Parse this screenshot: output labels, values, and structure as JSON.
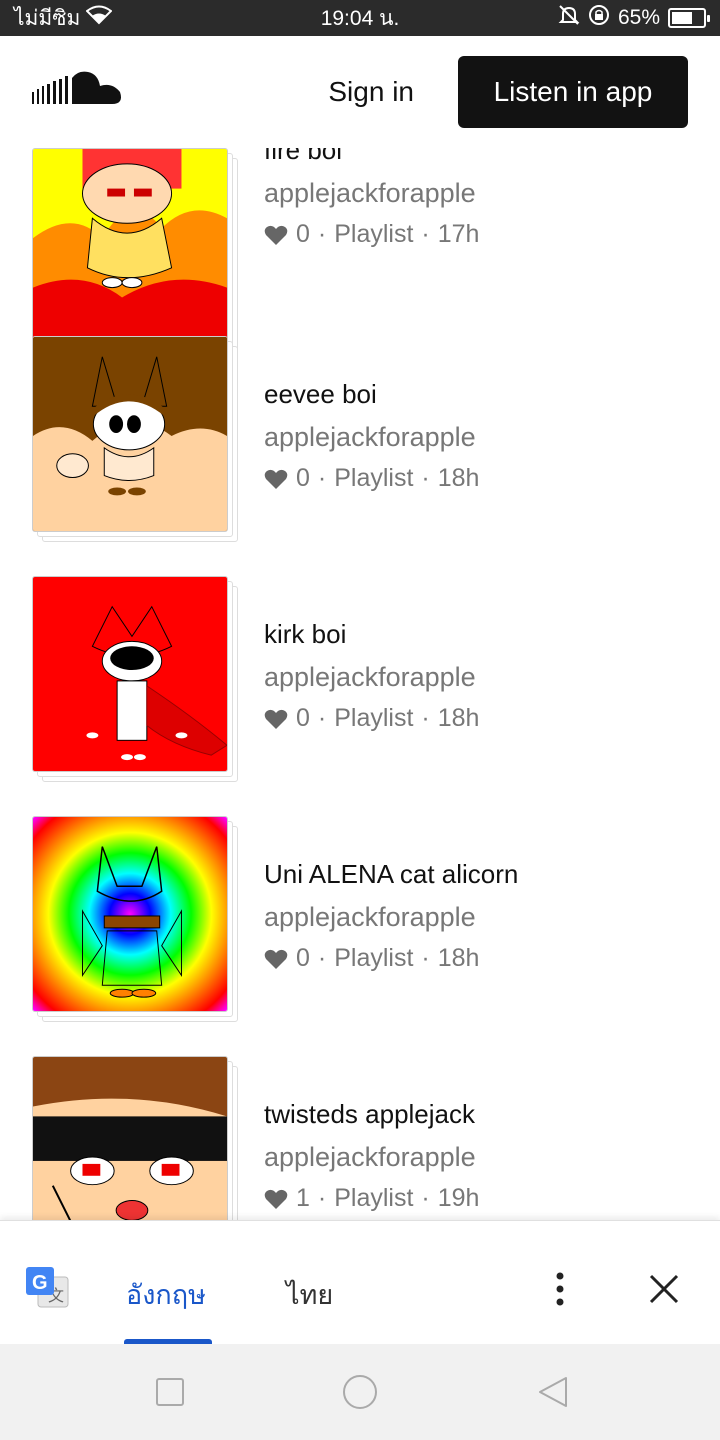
{
  "status": {
    "carrier": "ไม่มีซิม",
    "time": "19:04 น.",
    "battery": "65%",
    "battery_level": 0.65
  },
  "header": {
    "logo": "soundcloud-logo",
    "signin_label": "Sign in",
    "listen_label": "Listen in app"
  },
  "playlists": [
    {
      "title": "fire boi",
      "user": "applejackforapple",
      "likes": "0",
      "type": "Playlist",
      "age": "17h",
      "art": "fire-cat-artwork"
    },
    {
      "title": "eevee boi",
      "user": "applejackforapple",
      "likes": "0",
      "type": "Playlist",
      "age": "18h",
      "art": "eevee-cat-artwork"
    },
    {
      "title": "kirk boi",
      "user": "applejackforapple",
      "likes": "0",
      "type": "Playlist",
      "age": "18h",
      "art": "red-cat-artwork"
    },
    {
      "title": "Uni ALENA cat alicorn",
      "user": "applejackforapple",
      "likes": "0",
      "type": "Playlist",
      "age": "18h",
      "art": "rainbow-cat-artwork"
    },
    {
      "title": "twisteds applejack",
      "user": "applejackforapple",
      "likes": "1",
      "type": "Playlist",
      "age": "19h",
      "art": "applejack-face-artwork"
    }
  ],
  "translate": {
    "lang_source": "อังกฤษ",
    "lang_target": "ไทย"
  },
  "colors": {
    "accent": "#1a57c9",
    "button_dark": "#121212",
    "meta_gray": "#777777"
  }
}
